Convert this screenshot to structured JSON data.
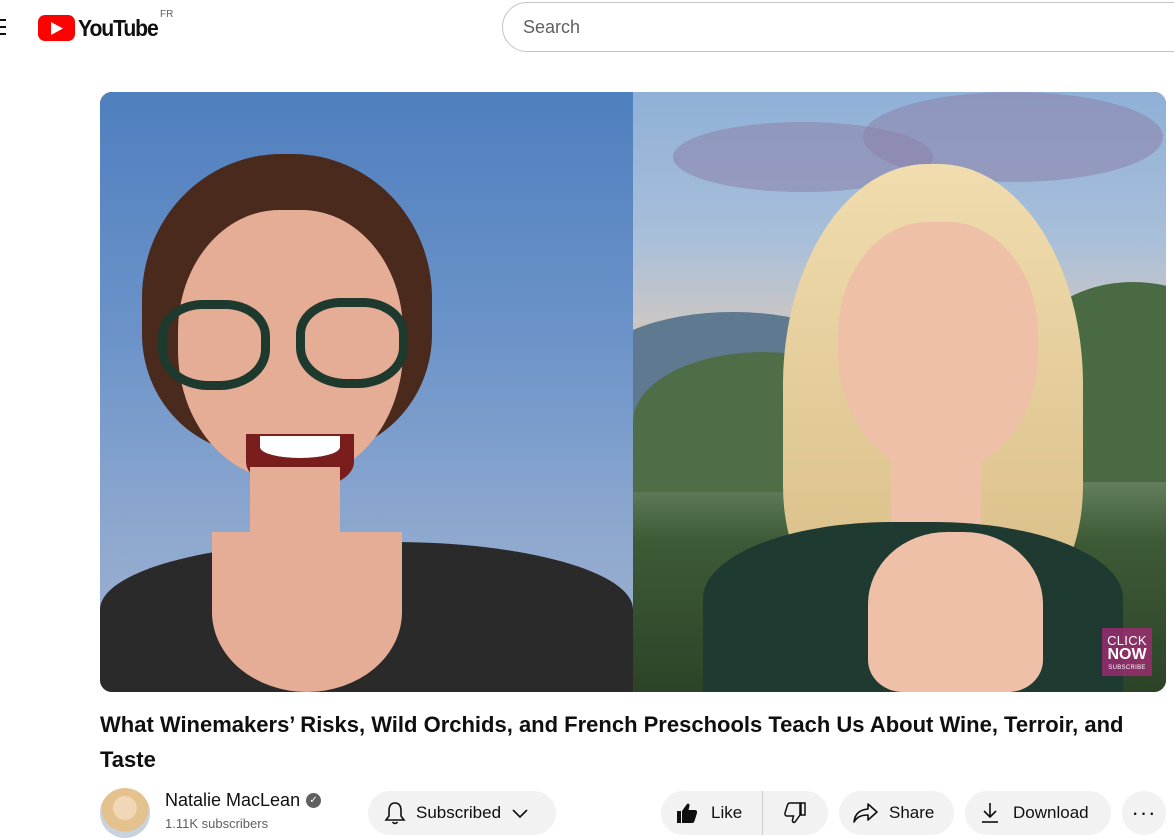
{
  "header": {
    "logo_text": "YouTube",
    "country_code": "FR",
    "search_placeholder": "Search"
  },
  "video": {
    "overlay": {
      "line1": "CLICK",
      "line2": "NOW",
      "line3": "SUBSCRIBE"
    },
    "title": "What Winemakers’ Risks, Wild Orchids, and French Preschools Teach Us About Wine, Terroir, and Taste"
  },
  "channel": {
    "name": "Natalie MacLean",
    "subscribers": "1.11K subscribers",
    "verified": true
  },
  "actions": {
    "subscribe_label": "Subscribed",
    "like_label": "Like",
    "share_label": "Share",
    "download_label": "Download",
    "more_label": "···"
  },
  "colors": {
    "brand_red": "#ff0000",
    "button_bg": "#f2f2f2"
  },
  "icons": [
    "menu-icon",
    "youtube-logo-icon",
    "verified-icon",
    "bell-icon",
    "chevron-down-icon",
    "thumbs-up-icon",
    "thumbs-down-icon",
    "share-icon",
    "download-icon",
    "more-icon"
  ]
}
